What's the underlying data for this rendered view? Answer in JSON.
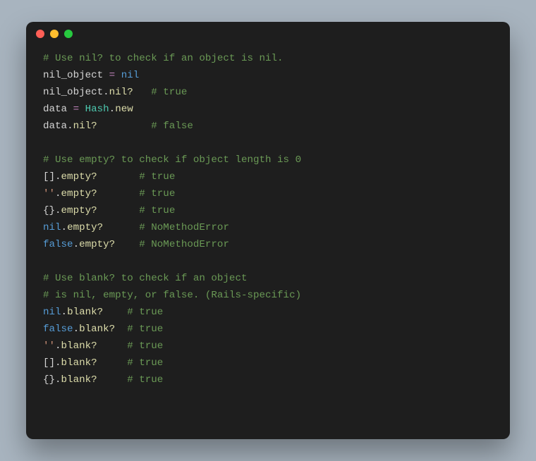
{
  "code": {
    "lines": [
      [
        {
          "t": "# Use nil? to check if an object is nil.",
          "c": "comment"
        }
      ],
      [
        {
          "t": "nil_object",
          "c": "ident"
        },
        {
          "t": " ",
          "c": "punct"
        },
        {
          "t": "=",
          "c": "op"
        },
        {
          "t": " ",
          "c": "punct"
        },
        {
          "t": "nil",
          "c": "keyword"
        }
      ],
      [
        {
          "t": "nil_object",
          "c": "ident"
        },
        {
          "t": ".",
          "c": "punct"
        },
        {
          "t": "nil?",
          "c": "method"
        },
        {
          "t": "   ",
          "c": "punct"
        },
        {
          "t": "# true",
          "c": "comment"
        }
      ],
      [
        {
          "t": "data",
          "c": "ident"
        },
        {
          "t": " ",
          "c": "punct"
        },
        {
          "t": "=",
          "c": "op"
        },
        {
          "t": " ",
          "c": "punct"
        },
        {
          "t": "Hash",
          "c": "class"
        },
        {
          "t": ".",
          "c": "punct"
        },
        {
          "t": "new",
          "c": "method"
        }
      ],
      [
        {
          "t": "data",
          "c": "ident"
        },
        {
          "t": ".",
          "c": "punct"
        },
        {
          "t": "nil?",
          "c": "method"
        },
        {
          "t": "         ",
          "c": "punct"
        },
        {
          "t": "# false",
          "c": "comment"
        }
      ],
      [],
      [
        {
          "t": "# Use empty? to check if object length is 0",
          "c": "comment"
        }
      ],
      [
        {
          "t": "[]",
          "c": "punct"
        },
        {
          "t": ".",
          "c": "punct"
        },
        {
          "t": "empty?",
          "c": "method"
        },
        {
          "t": "       ",
          "c": "punct"
        },
        {
          "t": "# true",
          "c": "comment"
        }
      ],
      [
        {
          "t": "''",
          "c": "string"
        },
        {
          "t": ".",
          "c": "punct"
        },
        {
          "t": "empty?",
          "c": "method"
        },
        {
          "t": "       ",
          "c": "punct"
        },
        {
          "t": "# true",
          "c": "comment"
        }
      ],
      [
        {
          "t": "{}",
          "c": "punct"
        },
        {
          "t": ".",
          "c": "punct"
        },
        {
          "t": "empty?",
          "c": "method"
        },
        {
          "t": "       ",
          "c": "punct"
        },
        {
          "t": "# true",
          "c": "comment"
        }
      ],
      [
        {
          "t": "nil",
          "c": "keyword"
        },
        {
          "t": ".",
          "c": "punct"
        },
        {
          "t": "empty?",
          "c": "method"
        },
        {
          "t": "      ",
          "c": "punct"
        },
        {
          "t": "# NoMethodError",
          "c": "comment"
        }
      ],
      [
        {
          "t": "false",
          "c": "keyword"
        },
        {
          "t": ".",
          "c": "punct"
        },
        {
          "t": "empty?",
          "c": "method"
        },
        {
          "t": "    ",
          "c": "punct"
        },
        {
          "t": "# NoMethodError",
          "c": "comment"
        }
      ],
      [],
      [
        {
          "t": "# Use blank? to check if an object",
          "c": "comment"
        }
      ],
      [
        {
          "t": "# is nil, empty, or false. (Rails-specific)",
          "c": "comment"
        }
      ],
      [
        {
          "t": "nil",
          "c": "keyword"
        },
        {
          "t": ".",
          "c": "punct"
        },
        {
          "t": "blank?",
          "c": "method"
        },
        {
          "t": "    ",
          "c": "punct"
        },
        {
          "t": "# true",
          "c": "comment"
        }
      ],
      [
        {
          "t": "false",
          "c": "keyword"
        },
        {
          "t": ".",
          "c": "punct"
        },
        {
          "t": "blank?",
          "c": "method"
        },
        {
          "t": "  ",
          "c": "punct"
        },
        {
          "t": "# true",
          "c": "comment"
        }
      ],
      [
        {
          "t": "''",
          "c": "string"
        },
        {
          "t": ".",
          "c": "punct"
        },
        {
          "t": "blank?",
          "c": "method"
        },
        {
          "t": "     ",
          "c": "punct"
        },
        {
          "t": "# true",
          "c": "comment"
        }
      ],
      [
        {
          "t": "[]",
          "c": "punct"
        },
        {
          "t": ".",
          "c": "punct"
        },
        {
          "t": "blank?",
          "c": "method"
        },
        {
          "t": "     ",
          "c": "punct"
        },
        {
          "t": "# true",
          "c": "comment"
        }
      ],
      [
        {
          "t": "{}",
          "c": "punct"
        },
        {
          "t": ".",
          "c": "punct"
        },
        {
          "t": "blank?",
          "c": "method"
        },
        {
          "t": "     ",
          "c": "punct"
        },
        {
          "t": "# true",
          "c": "comment"
        }
      ]
    ]
  }
}
